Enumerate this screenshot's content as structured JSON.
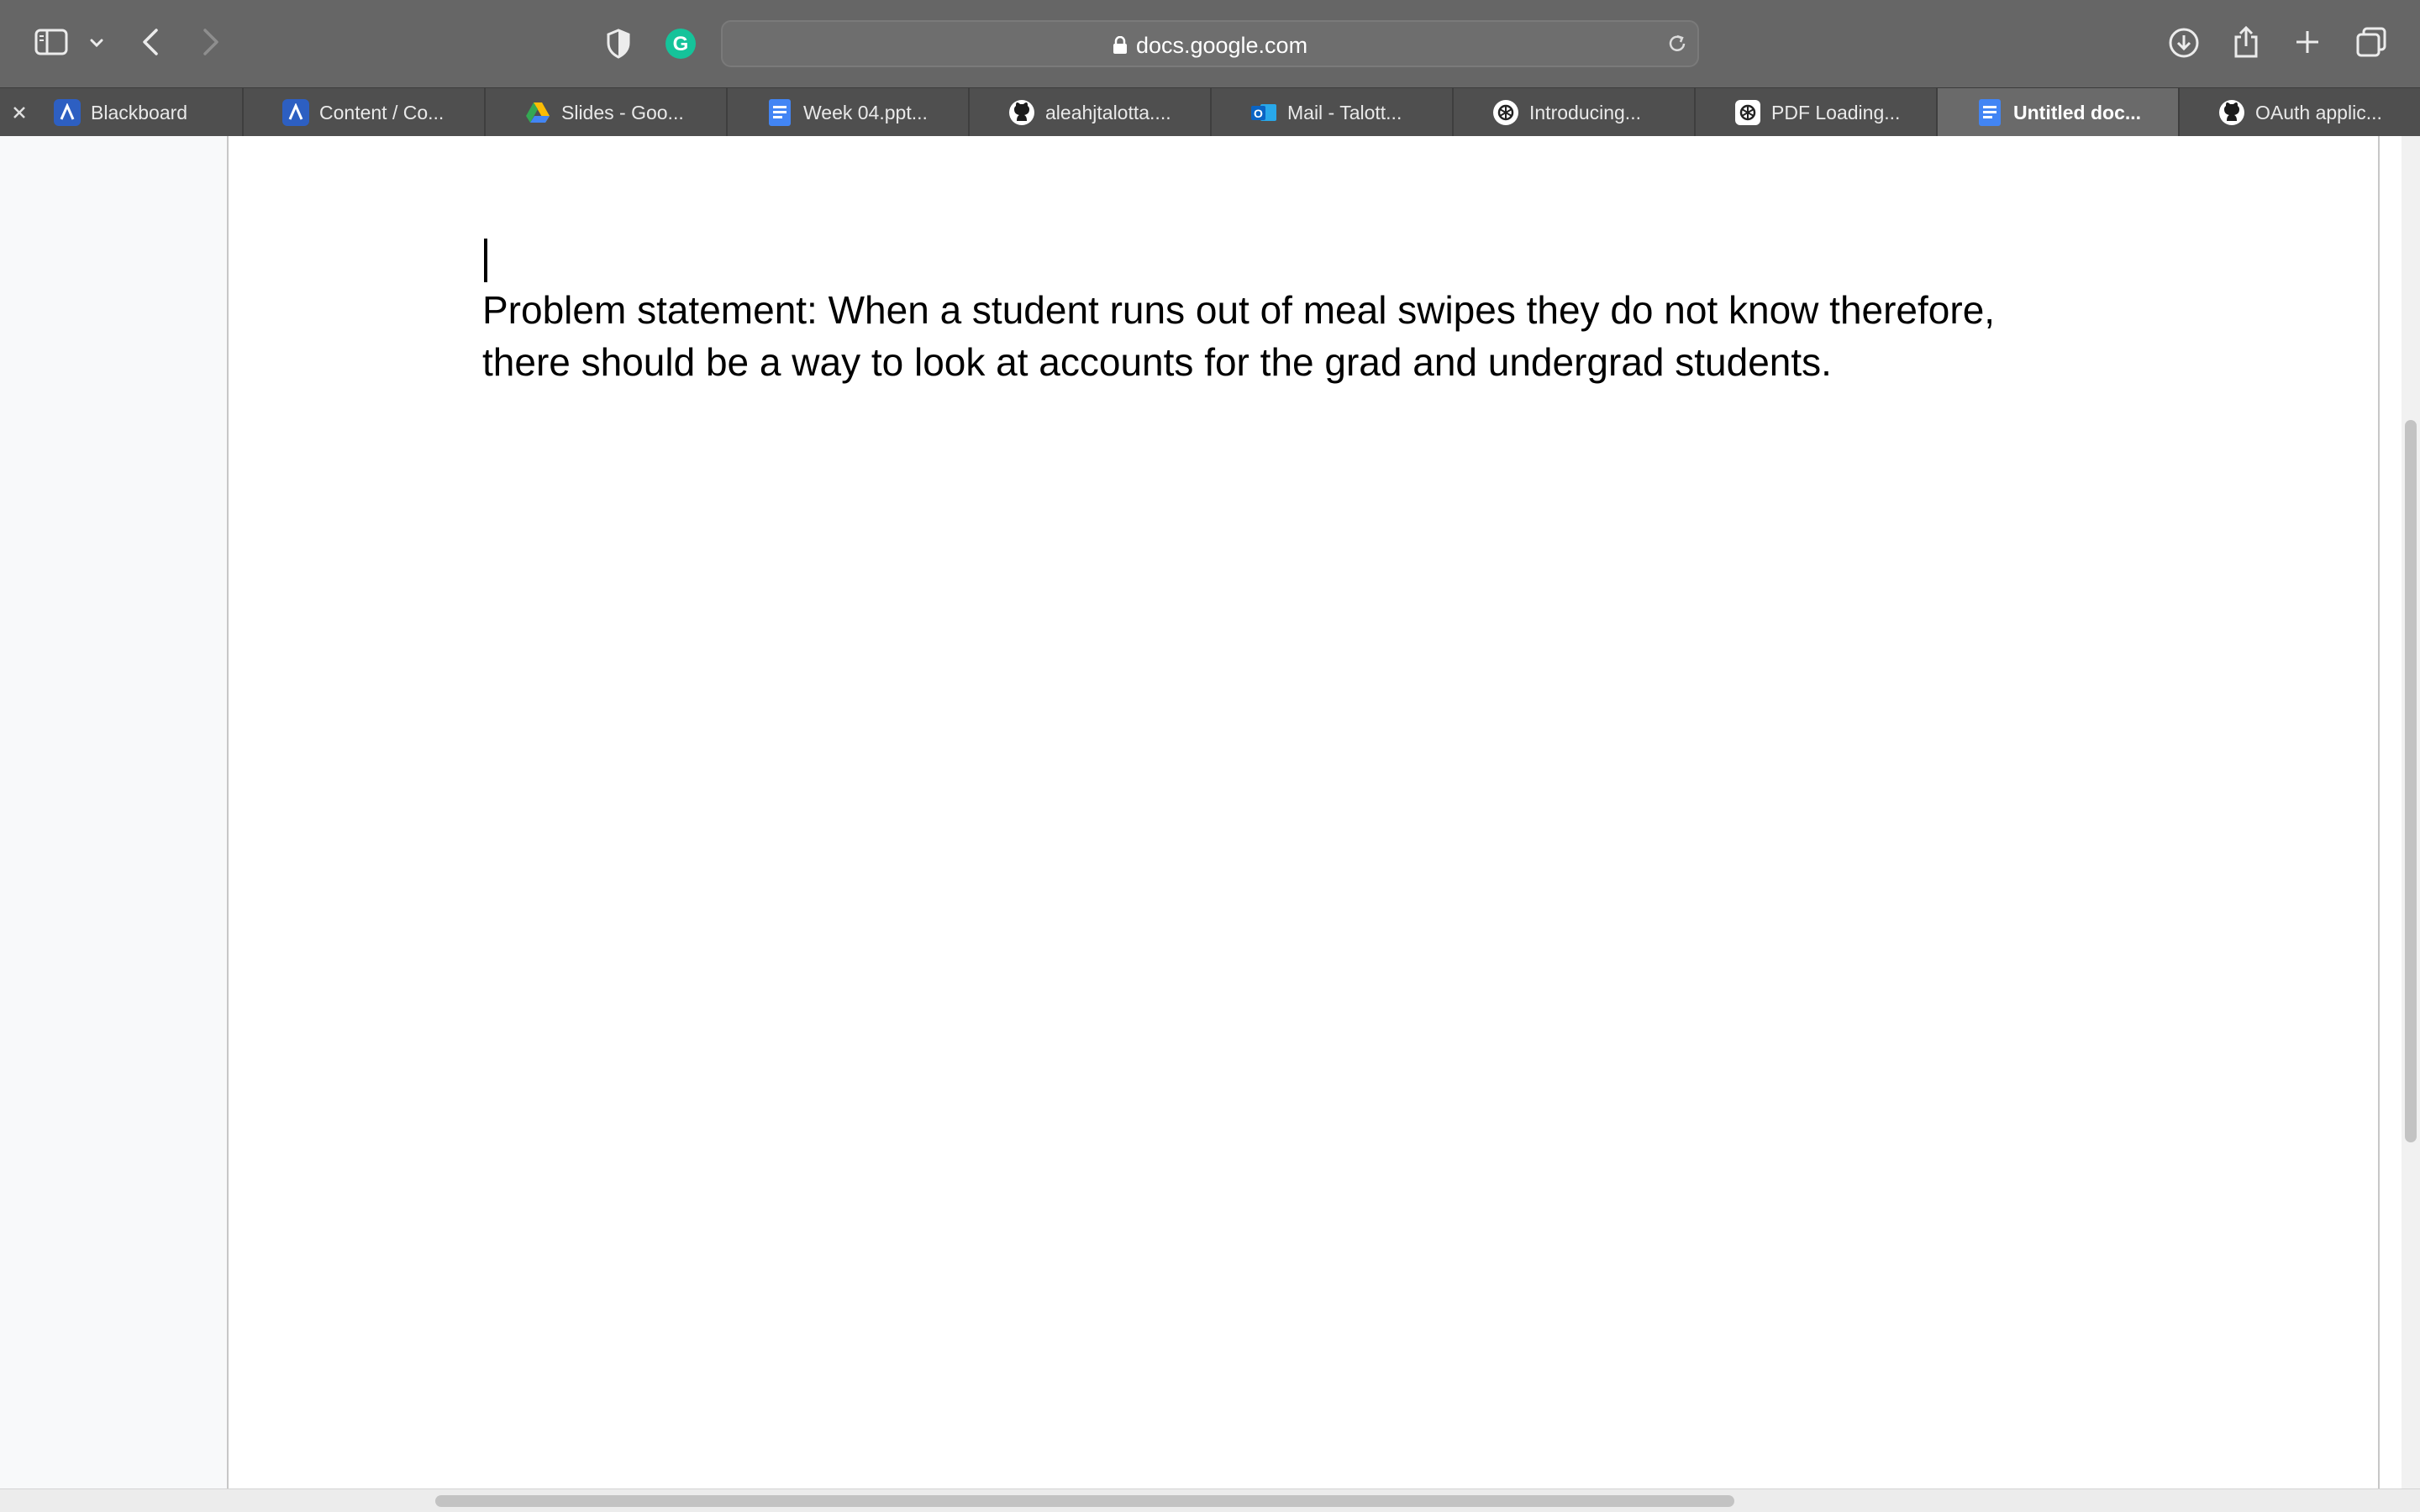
{
  "browser": {
    "address": "docs.google.com",
    "tabs": [
      {
        "label": "Blackboard",
        "icon": "blackboard-icon",
        "active": false
      },
      {
        "label": "Content / Co...",
        "icon": "blackboard-icon",
        "active": false
      },
      {
        "label": "Slides - Goo...",
        "icon": "google-drive-icon",
        "active": false
      },
      {
        "label": "Week 04.ppt...",
        "icon": "google-docs-icon",
        "active": false
      },
      {
        "label": "aleahjtalotta....",
        "icon": "github-icon",
        "active": false
      },
      {
        "label": "Mail - Talott...",
        "icon": "outlook-icon",
        "active": false
      },
      {
        "label": "Introducing...",
        "icon": "openai-icon",
        "active": false
      },
      {
        "label": "PDF Loading...",
        "icon": "openai-icon",
        "active": false
      },
      {
        "label": "Untitled doc...",
        "icon": "google-docs-icon",
        "active": true
      },
      {
        "label": "OAuth applic...",
        "icon": "github-icon",
        "active": false
      }
    ]
  },
  "document": {
    "body": "Problem statement: When a student runs out of meal swipes they do not know therefore, there should be a way to look at accounts for the grad and undergrad students."
  },
  "colors": {
    "toolbar": "#666666",
    "tabbar": "#4f4f4f",
    "active_tab": "#6a6a6a",
    "docs_blue": "#4285f4",
    "grammarly_green": "#15c39a"
  }
}
